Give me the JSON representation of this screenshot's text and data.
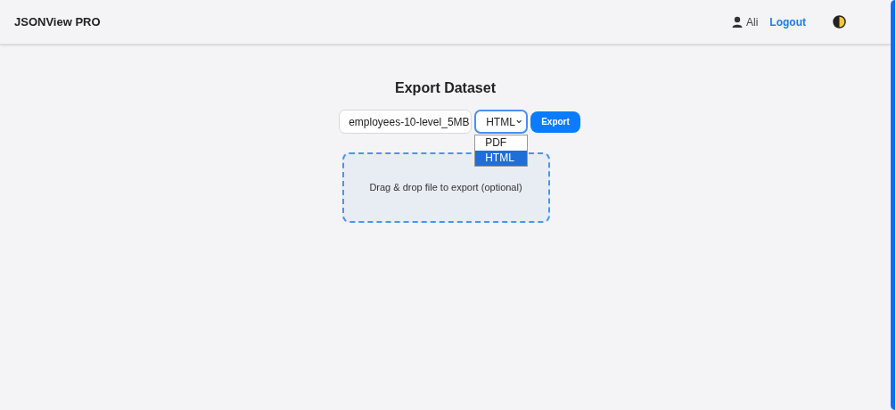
{
  "header": {
    "brand": "JSONView PRO",
    "user": "Ali",
    "logout": "Logout"
  },
  "title": "Export Dataset",
  "dataset_select": {
    "value": "employees-10-level_5MB"
  },
  "format_select": {
    "value": "HTML",
    "expanded": true,
    "options": [
      {
        "label": "PDF",
        "selected": false
      },
      {
        "label": "HTML",
        "selected": true
      }
    ]
  },
  "export_button": "Export",
  "dropzone": {
    "text": "Drag & drop file to export (optional)"
  }
}
